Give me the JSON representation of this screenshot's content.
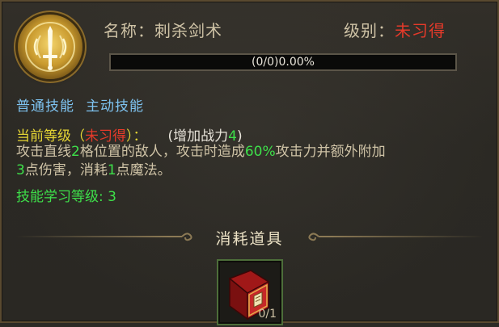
{
  "skill": {
    "name_label": "名称：",
    "name_value": "刺杀剑术",
    "level_label": "级别：",
    "level_value": "未习得",
    "progress_text": "(0/0)0.00%",
    "progress_value": 0.0
  },
  "tags": [
    "普通技能",
    "主动技能"
  ],
  "current_level": {
    "prefix": "当前等级（",
    "status": "未习得",
    "suffix": "）：",
    "power_open": "(增加战力",
    "power_value": "4",
    "power_close": ")"
  },
  "description": {
    "p1": "攻击直线",
    "n1": "2",
    "p2": "格位置的敌人，攻击时造成",
    "n2": "60%",
    "p3": "攻击力并额外附加",
    "n3": "3",
    "p4": "点伤害，消耗",
    "n4": "1",
    "p5": "点魔法。"
  },
  "learn_level": "技能学习等级: 3",
  "consumables": {
    "title": "消耗道具",
    "item_count": "0/1"
  },
  "colors": {
    "accent_red": "#e53a2a",
    "accent_yellow": "#e6d634",
    "accent_green": "#3ee04a",
    "accent_blue": "#7ec3f0"
  },
  "icons": {
    "skill": "sword-emblem-icon",
    "item": "skill-book-icon"
  }
}
